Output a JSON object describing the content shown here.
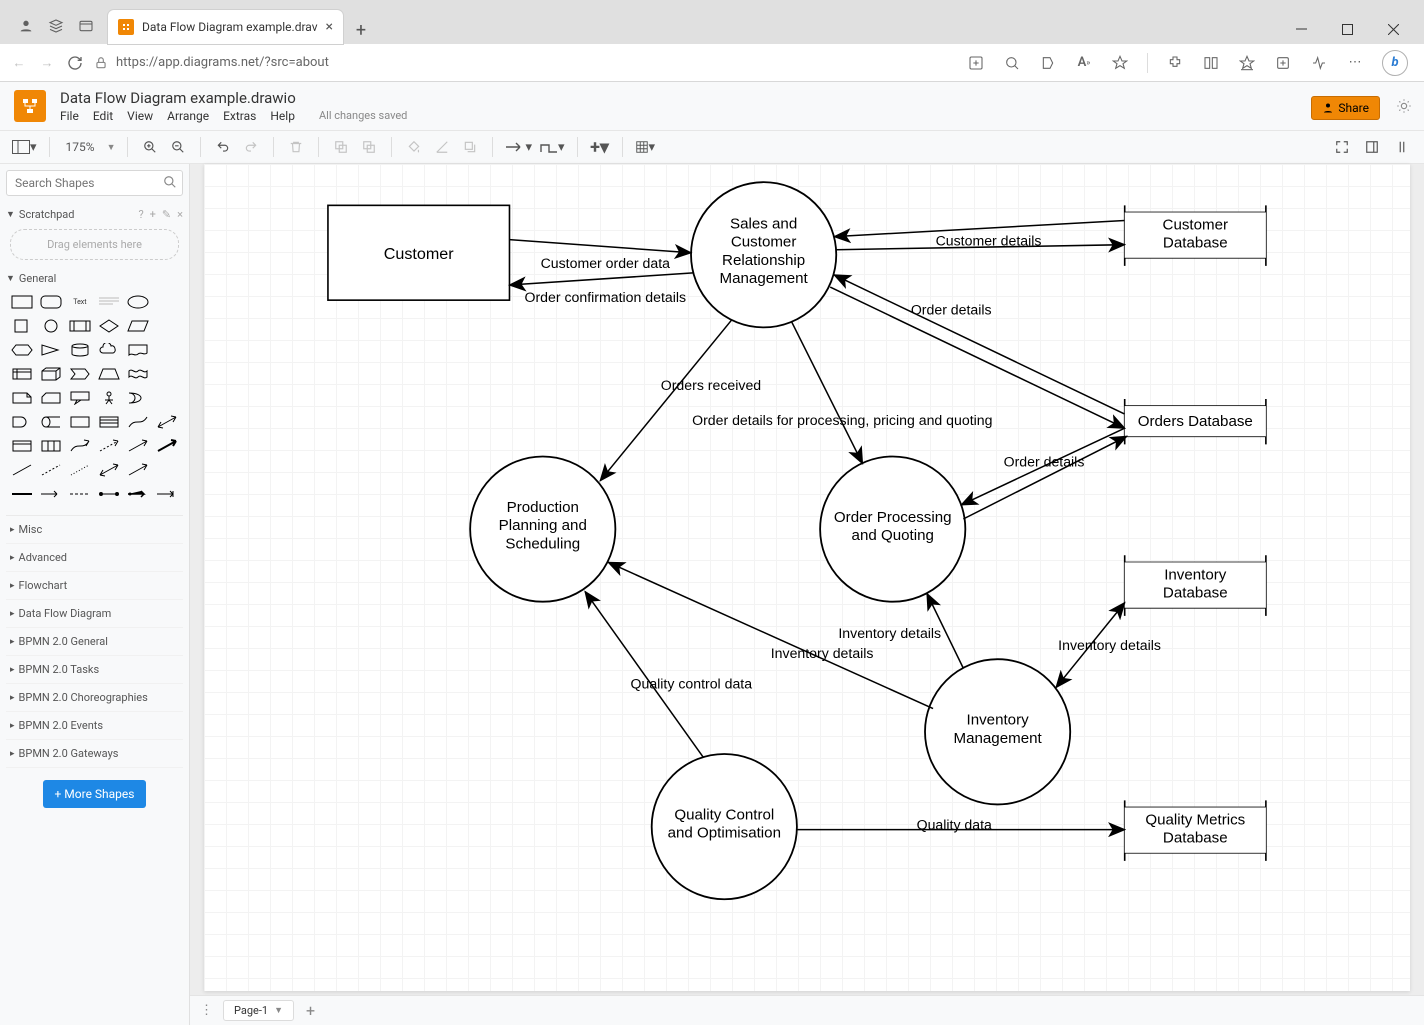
{
  "browser": {
    "tab_title": "Data Flow Diagram example.drav",
    "url_display": "https://app.diagrams.net/?src=about"
  },
  "app": {
    "file_name": "Data Flow Diagram example.drawio",
    "menu": [
      "File",
      "Edit",
      "View",
      "Arrange",
      "Extras",
      "Help"
    ],
    "saved": "All changes saved",
    "share": "Share",
    "zoom": "175%"
  },
  "sidebar": {
    "search_placeholder": "Search Shapes",
    "scratchpad": "Scratchpad",
    "scratchpad_hint": "Drag elements here",
    "general": "General",
    "categories": [
      "Misc",
      "Advanced",
      "Flowchart",
      "Data Flow Diagram",
      "BPMN 2.0 General",
      "BPMN 2.0 Tasks",
      "BPMN 2.0 Choreographies",
      "BPMN 2.0 Events",
      "BPMN 2.0 Gateways"
    ],
    "more_shapes": "+ More Shapes"
  },
  "pages": {
    "current": "Page-1"
  },
  "diagram": {
    "entities": {
      "customer": "Customer",
      "customer_db": "Customer Database",
      "orders_db": "Orders Database",
      "inventory_db": "Inventory Database",
      "quality_db": "Quality Metrics Database"
    },
    "processes": {
      "scrm": "Sales and Customer Relationship Management",
      "pps": "Production Planning and Scheduling",
      "opq": "Order Processing and Quoting",
      "im": "Inventory Management",
      "qco": "Quality Control and Optimisation"
    },
    "flows": {
      "cust_order": "Customer order data",
      "order_conf": "Order confirmation details",
      "cust_details": "Customer details",
      "order_details_db": "Order details",
      "orders_received": "Orders received",
      "order_proc": "Order details for processing, pricing and quoting",
      "order_details_opq": "Order details",
      "inv_pps": "Inventory details",
      "inv_opq": "Inventory details",
      "inv_db": "Inventory details",
      "qcd": "Quality control data",
      "qdata": "Quality data"
    }
  }
}
